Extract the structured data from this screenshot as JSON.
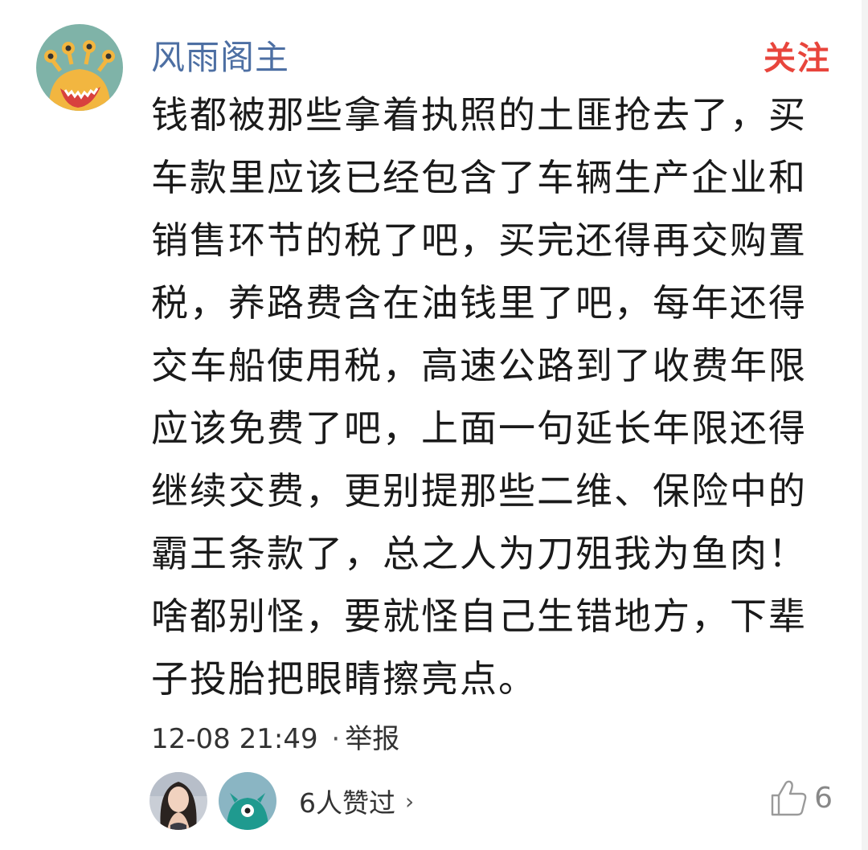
{
  "post": {
    "username": "风雨阁主",
    "follow_label": "关注",
    "comment_lines": [
      "钱都被那些拿着执照的土匪抢去了，买",
      "车款里应该已经包含了车辆生产企业和",
      "销售环节的税了吧，买完还得再交购置",
      "税，养路费含在油钱里了吧，每年还得",
      "交车船使用税，高速公路到了收费年限",
      "应该免费了吧，上面一句延长年限还得",
      "继续交费，更别提那些二维、保险中的",
      "霸王条款了，总之人为刀殂我为鱼肉！",
      "啥都别怪，要就怪自己生错地方，下辈",
      "子投胎把眼睛擦亮点。"
    ],
    "timestamp": "12-08 21:49",
    "separator": "·",
    "report_label": "举报",
    "likers_text": "6人赞过",
    "likers_chevron": "›",
    "like_count": "6"
  },
  "colors": {
    "username": "#4d6fa3",
    "follow": "#e8453c",
    "avatar_bg": "#7fb3a8",
    "avatar_monster": "#f2b640"
  },
  "icons": {
    "user_avatar": "monster-avatar-icon",
    "liker_1": "woman-photo-avatar",
    "liker_2": "teal-monster-avatar-icon",
    "like": "thumbs-up-icon"
  }
}
